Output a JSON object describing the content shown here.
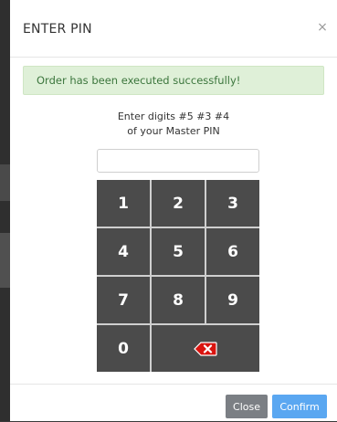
{
  "modal": {
    "title": "ENTER PIN",
    "close_glyph": "×",
    "alert_message": "Order has been executed successfully!",
    "instruction_line1": "Enter digits #5 #3 #4",
    "instruction_line2": "of your Master PIN",
    "pin_input_value": ""
  },
  "keypad": {
    "keys": [
      "1",
      "2",
      "3",
      "4",
      "5",
      "6",
      "7",
      "8",
      "9",
      "0"
    ],
    "backspace_icon": "backspace-icon"
  },
  "footer": {
    "close_label": "Close",
    "confirm_label": "Confirm"
  },
  "colors": {
    "alert_bg": "#dff0d8",
    "alert_text": "#3c763d",
    "key_bg": "#4b4b4b",
    "close_button": "#7b7f84",
    "confirm_button": "#5aa7f1",
    "backspace_red": "#d9140f"
  }
}
